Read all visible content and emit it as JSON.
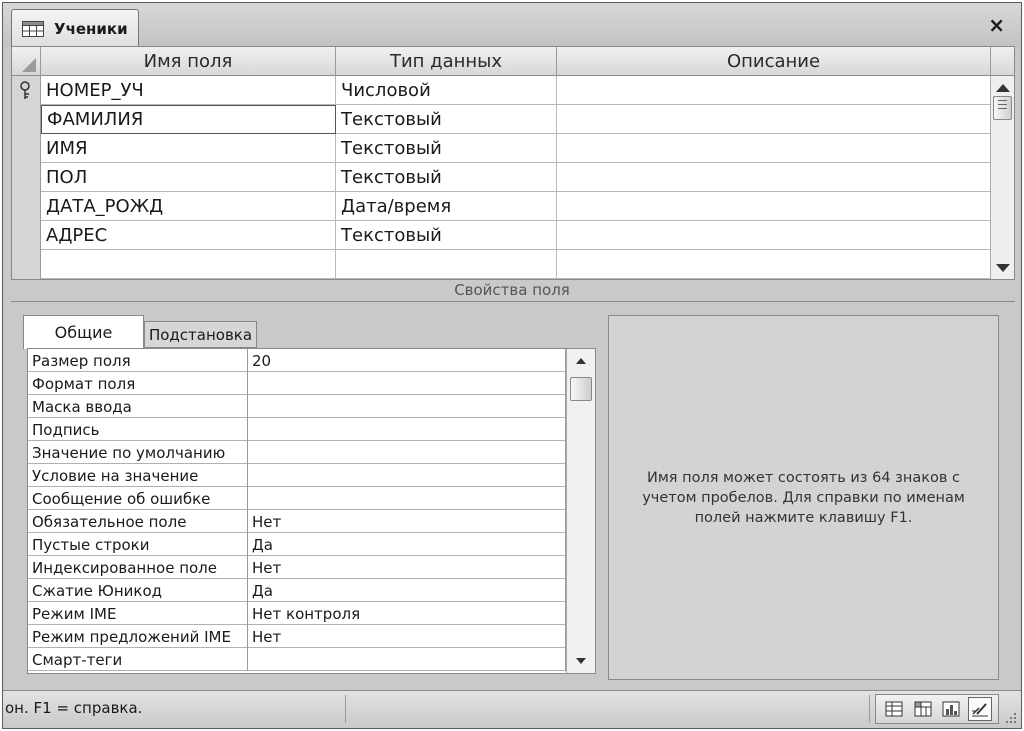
{
  "tab": {
    "title": "Ученики",
    "icon": "table-icon"
  },
  "close_label": "×",
  "grid": {
    "columns": [
      "Имя поля",
      "Тип данных",
      "Описание"
    ],
    "rows": [
      {
        "name": "НОМЕР_УЧ",
        "type": "Числовой",
        "description": "",
        "primary_key": true
      },
      {
        "name": "ФАМИЛИЯ",
        "type": "Текстовый",
        "description": ""
      },
      {
        "name": "ИМЯ",
        "type": "Текстовый",
        "description": ""
      },
      {
        "name": "ПОЛ",
        "type": "Текстовый",
        "description": ""
      },
      {
        "name": "ДАТА_РОЖД",
        "type": "Дата/время",
        "description": ""
      },
      {
        "name": "АДРЕС",
        "type": "Текстовый",
        "description": ""
      },
      {
        "name": "",
        "type": "",
        "description": ""
      }
    ]
  },
  "field_properties_label": "Свойства поля",
  "property_tabs": [
    "Общие",
    "Подстановка"
  ],
  "properties": [
    {
      "label": "Размер поля",
      "value": "20"
    },
    {
      "label": "Формат поля",
      "value": ""
    },
    {
      "label": "Маска ввода",
      "value": ""
    },
    {
      "label": "Подпись",
      "value": ""
    },
    {
      "label": "Значение по умолчанию",
      "value": ""
    },
    {
      "label": "Условие на значение",
      "value": ""
    },
    {
      "label": "Сообщение об ошибке",
      "value": ""
    },
    {
      "label": "Обязательное поле",
      "value": "Нет"
    },
    {
      "label": "Пустые строки",
      "value": "Да"
    },
    {
      "label": "Индексированное поле",
      "value": "Нет"
    },
    {
      "label": "Сжатие Юникод",
      "value": "Да"
    },
    {
      "label": "Режим IME",
      "value": "Нет контроля"
    },
    {
      "label": "Режим предложений IME",
      "value": "Нет"
    },
    {
      "label": "Смарт-теги",
      "value": ""
    }
  ],
  "help_text": "Имя поля может состоять из 64 знаков с учетом пробелов.  Для справки по именам полей нажмите клавишу F1.",
  "status": {
    "text": "он.  F1 = справка."
  },
  "view_buttons": [
    "datasheet-view-icon",
    "pivot-table-icon",
    "pivot-chart-icon",
    "design-view-icon"
  ]
}
